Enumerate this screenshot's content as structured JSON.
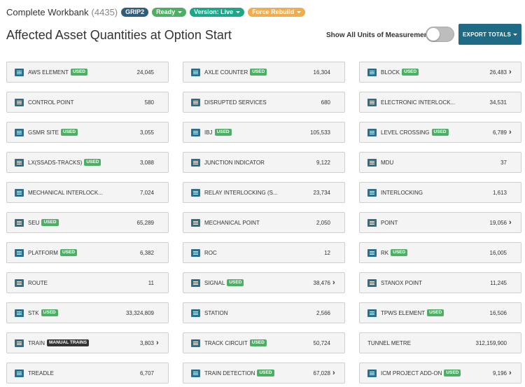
{
  "header": {
    "title": "Complete Workbank",
    "count": "(4435)",
    "pills": [
      {
        "label": "GRIP2",
        "dropdown": false
      },
      {
        "label": "Ready",
        "dropdown": true
      },
      {
        "label": "Version: Live",
        "dropdown": true
      },
      {
        "label": "Force Rebuild",
        "dropdown": true
      }
    ]
  },
  "page_title": "Affected Asset Quantities at Option Start",
  "toggle": {
    "label": "Show All Units of Measurement",
    "on": false
  },
  "export": {
    "label": "EXPORT TOTALS"
  },
  "colors": {
    "icon": "#2b6f8c",
    "used_badge": "#4caf63",
    "manual_badge": "#333333",
    "export": "#1f6b85"
  },
  "cards": [
    {
      "name": "AWS ELEMENT",
      "badge": "USED",
      "value": "24,045",
      "chevron": false,
      "icon": true
    },
    {
      "name": "AXLE COUNTER",
      "badge": "USED",
      "value": "16,304",
      "chevron": false,
      "icon": true
    },
    {
      "name": "BLOCK",
      "badge": "USED",
      "value": "26,483",
      "chevron": true,
      "icon": true
    },
    {
      "name": "CONTROL POINT",
      "badge": "",
      "value": "580",
      "chevron": false,
      "icon": true
    },
    {
      "name": "DISRUPTED SERVICES",
      "badge": "",
      "value": "680",
      "chevron": false,
      "icon": true
    },
    {
      "name": "ELECTRONIC INTERLOCK...",
      "badge": "",
      "value": "34,531",
      "chevron": false,
      "icon": true
    },
    {
      "name": "GSMR SITE",
      "badge": "USED",
      "value": "3,055",
      "chevron": false,
      "icon": true
    },
    {
      "name": "IBJ",
      "badge": "USED",
      "value": "105,533",
      "chevron": false,
      "icon": true
    },
    {
      "name": "LEVEL CROSSING",
      "badge": "USED",
      "value": "6,789",
      "chevron": true,
      "icon": true
    },
    {
      "name": "LX(SSADS-TRACKS)",
      "badge": "USED",
      "value": "3,088",
      "chevron": false,
      "icon": true
    },
    {
      "name": "JUNCTION INDICATOR",
      "badge": "",
      "value": "9,122",
      "chevron": false,
      "icon": true
    },
    {
      "name": "MDU",
      "badge": "",
      "value": "37",
      "chevron": false,
      "icon": true
    },
    {
      "name": "MECHANICAL INTERLOCK...",
      "badge": "",
      "value": "7,024",
      "chevron": false,
      "icon": true
    },
    {
      "name": "RELAY INTERLOCKING (S...",
      "badge": "",
      "value": "23,734",
      "chevron": false,
      "icon": true
    },
    {
      "name": "INTERLOCKING",
      "badge": "",
      "value": "1,613",
      "chevron": false,
      "icon": true
    },
    {
      "name": "SEU",
      "badge": "USED",
      "value": "65,289",
      "chevron": false,
      "icon": true
    },
    {
      "name": "MECHANICAL POINT",
      "badge": "",
      "value": "2,050",
      "chevron": false,
      "icon": true
    },
    {
      "name": "POINT",
      "badge": "",
      "value": "19,056",
      "chevron": true,
      "icon": true
    },
    {
      "name": "PLATFORM",
      "badge": "USED",
      "value": "6,382",
      "chevron": false,
      "icon": true
    },
    {
      "name": "ROC",
      "badge": "",
      "value": "12",
      "chevron": false,
      "icon": true
    },
    {
      "name": "RK",
      "badge": "USED",
      "value": "16,005",
      "chevron": false,
      "icon": true
    },
    {
      "name": "ROUTE",
      "badge": "",
      "value": "11",
      "chevron": false,
      "icon": true
    },
    {
      "name": "SIGNAL",
      "badge": "USED",
      "value": "38,476",
      "chevron": true,
      "icon": true
    },
    {
      "name": "STANOX POINT",
      "badge": "",
      "value": "11,245",
      "chevron": false,
      "icon": true
    },
    {
      "name": "STK",
      "badge": "USED",
      "value": "33,324,809",
      "chevron": false,
      "icon": true
    },
    {
      "name": "STATION",
      "badge": "",
      "value": "2,566",
      "chevron": false,
      "icon": true
    },
    {
      "name": "TPWS ELEMENT",
      "badge": "USED",
      "value": "16,506",
      "chevron": false,
      "icon": true
    },
    {
      "name": "TRAIN",
      "badge": "MANUAL TRAINS",
      "badge_style": "manual",
      "value": "3,803",
      "chevron": true,
      "icon": true
    },
    {
      "name": "TRACK CIRCUIT",
      "badge": "USED",
      "value": "50,724",
      "chevron": false,
      "icon": true
    },
    {
      "name": "TUNNEL METRE",
      "badge": "",
      "value": "312,159,900",
      "chevron": false,
      "icon": false
    },
    {
      "name": "TREADLE",
      "badge": "",
      "value": "6,707",
      "chevron": false,
      "icon": true
    },
    {
      "name": "TRAIN DETECTION",
      "badge": "USED",
      "value": "67,028",
      "chevron": true,
      "icon": true
    },
    {
      "name": "ICM PROJECT ADD-ON",
      "badge": "USED",
      "value": "9,196",
      "chevron": true,
      "icon": true
    }
  ]
}
